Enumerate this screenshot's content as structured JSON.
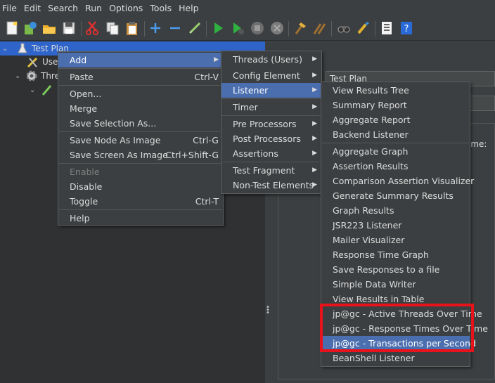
{
  "menubar": [
    "File",
    "Edit",
    "Search",
    "Run",
    "Options",
    "Tools",
    "Help"
  ],
  "toolbar_icons": [
    "new-icon",
    "templates-icon",
    "open-icon",
    "save-icon",
    "cut-icon",
    "copy-icon",
    "paste-icon",
    "expand-icon",
    "collapse-icon",
    "toggle-icon",
    "start-icon",
    "start-no-pause-icon",
    "stop-icon",
    "shutdown-icon",
    "clear-icon",
    "clear-all-icon",
    "search-icon",
    "reset-search-icon",
    "function-helper-icon",
    "help-icon"
  ],
  "tree": {
    "root": "Test Plan",
    "child1": "Use",
    "child2": "Thre"
  },
  "context_menu": {
    "items": [
      {
        "label": "Add",
        "submenu": true,
        "selected": true
      },
      {
        "label": "Paste",
        "accel": "Ctrl-V"
      },
      {
        "label": "Open..."
      },
      {
        "label": "Merge"
      },
      {
        "label": "Save Selection As..."
      },
      {
        "label": "Save Node As Image",
        "accel": "Ctrl-G"
      },
      {
        "label": "Save Screen As Image",
        "accel": "Ctrl+Shift-G"
      },
      {
        "label": "Enable",
        "disabled": true
      },
      {
        "label": "Disable"
      },
      {
        "label": "Toggle",
        "accel": "Ctrl-T"
      },
      {
        "label": "Help"
      }
    ]
  },
  "add_menu": {
    "items": [
      {
        "label": "Threads (Users)"
      },
      {
        "label": "Config Element"
      },
      {
        "label": "Listener",
        "selected": true
      },
      {
        "label": "Timer"
      },
      {
        "label": "Pre Processors"
      },
      {
        "label": "Post Processors"
      },
      {
        "label": "Assertions"
      },
      {
        "label": "Test Fragment"
      },
      {
        "label": "Non-Test Elements"
      }
    ]
  },
  "listener_menu": {
    "items": [
      "View Results Tree",
      "Summary Report",
      "Aggregate Report",
      "Backend Listener",
      "Aggregate Graph",
      "Assertion Results",
      "Comparison Assertion Visualizer",
      "Generate Summary Results",
      "Graph Results",
      "JSR223 Listener",
      "Mailer Visualizer",
      "Response Time Graph",
      "Save Responses to a file",
      "Simple Data Writer",
      "View Results in Table",
      "jp@gc - Active Threads Over Time",
      "jp@gc - Response Times Over Time",
      "jp@gc - Transactions per Second",
      "BeanShell Listener"
    ],
    "selected": "jp@gc - Transactions per Second"
  },
  "right_panel": {
    "name_value": "Test Plan",
    "column_header": "ame:"
  },
  "colors": {
    "selection": "#4b6eaf",
    "tree_selection": "#2f65ca",
    "highlight_box": "#e8121b"
  }
}
